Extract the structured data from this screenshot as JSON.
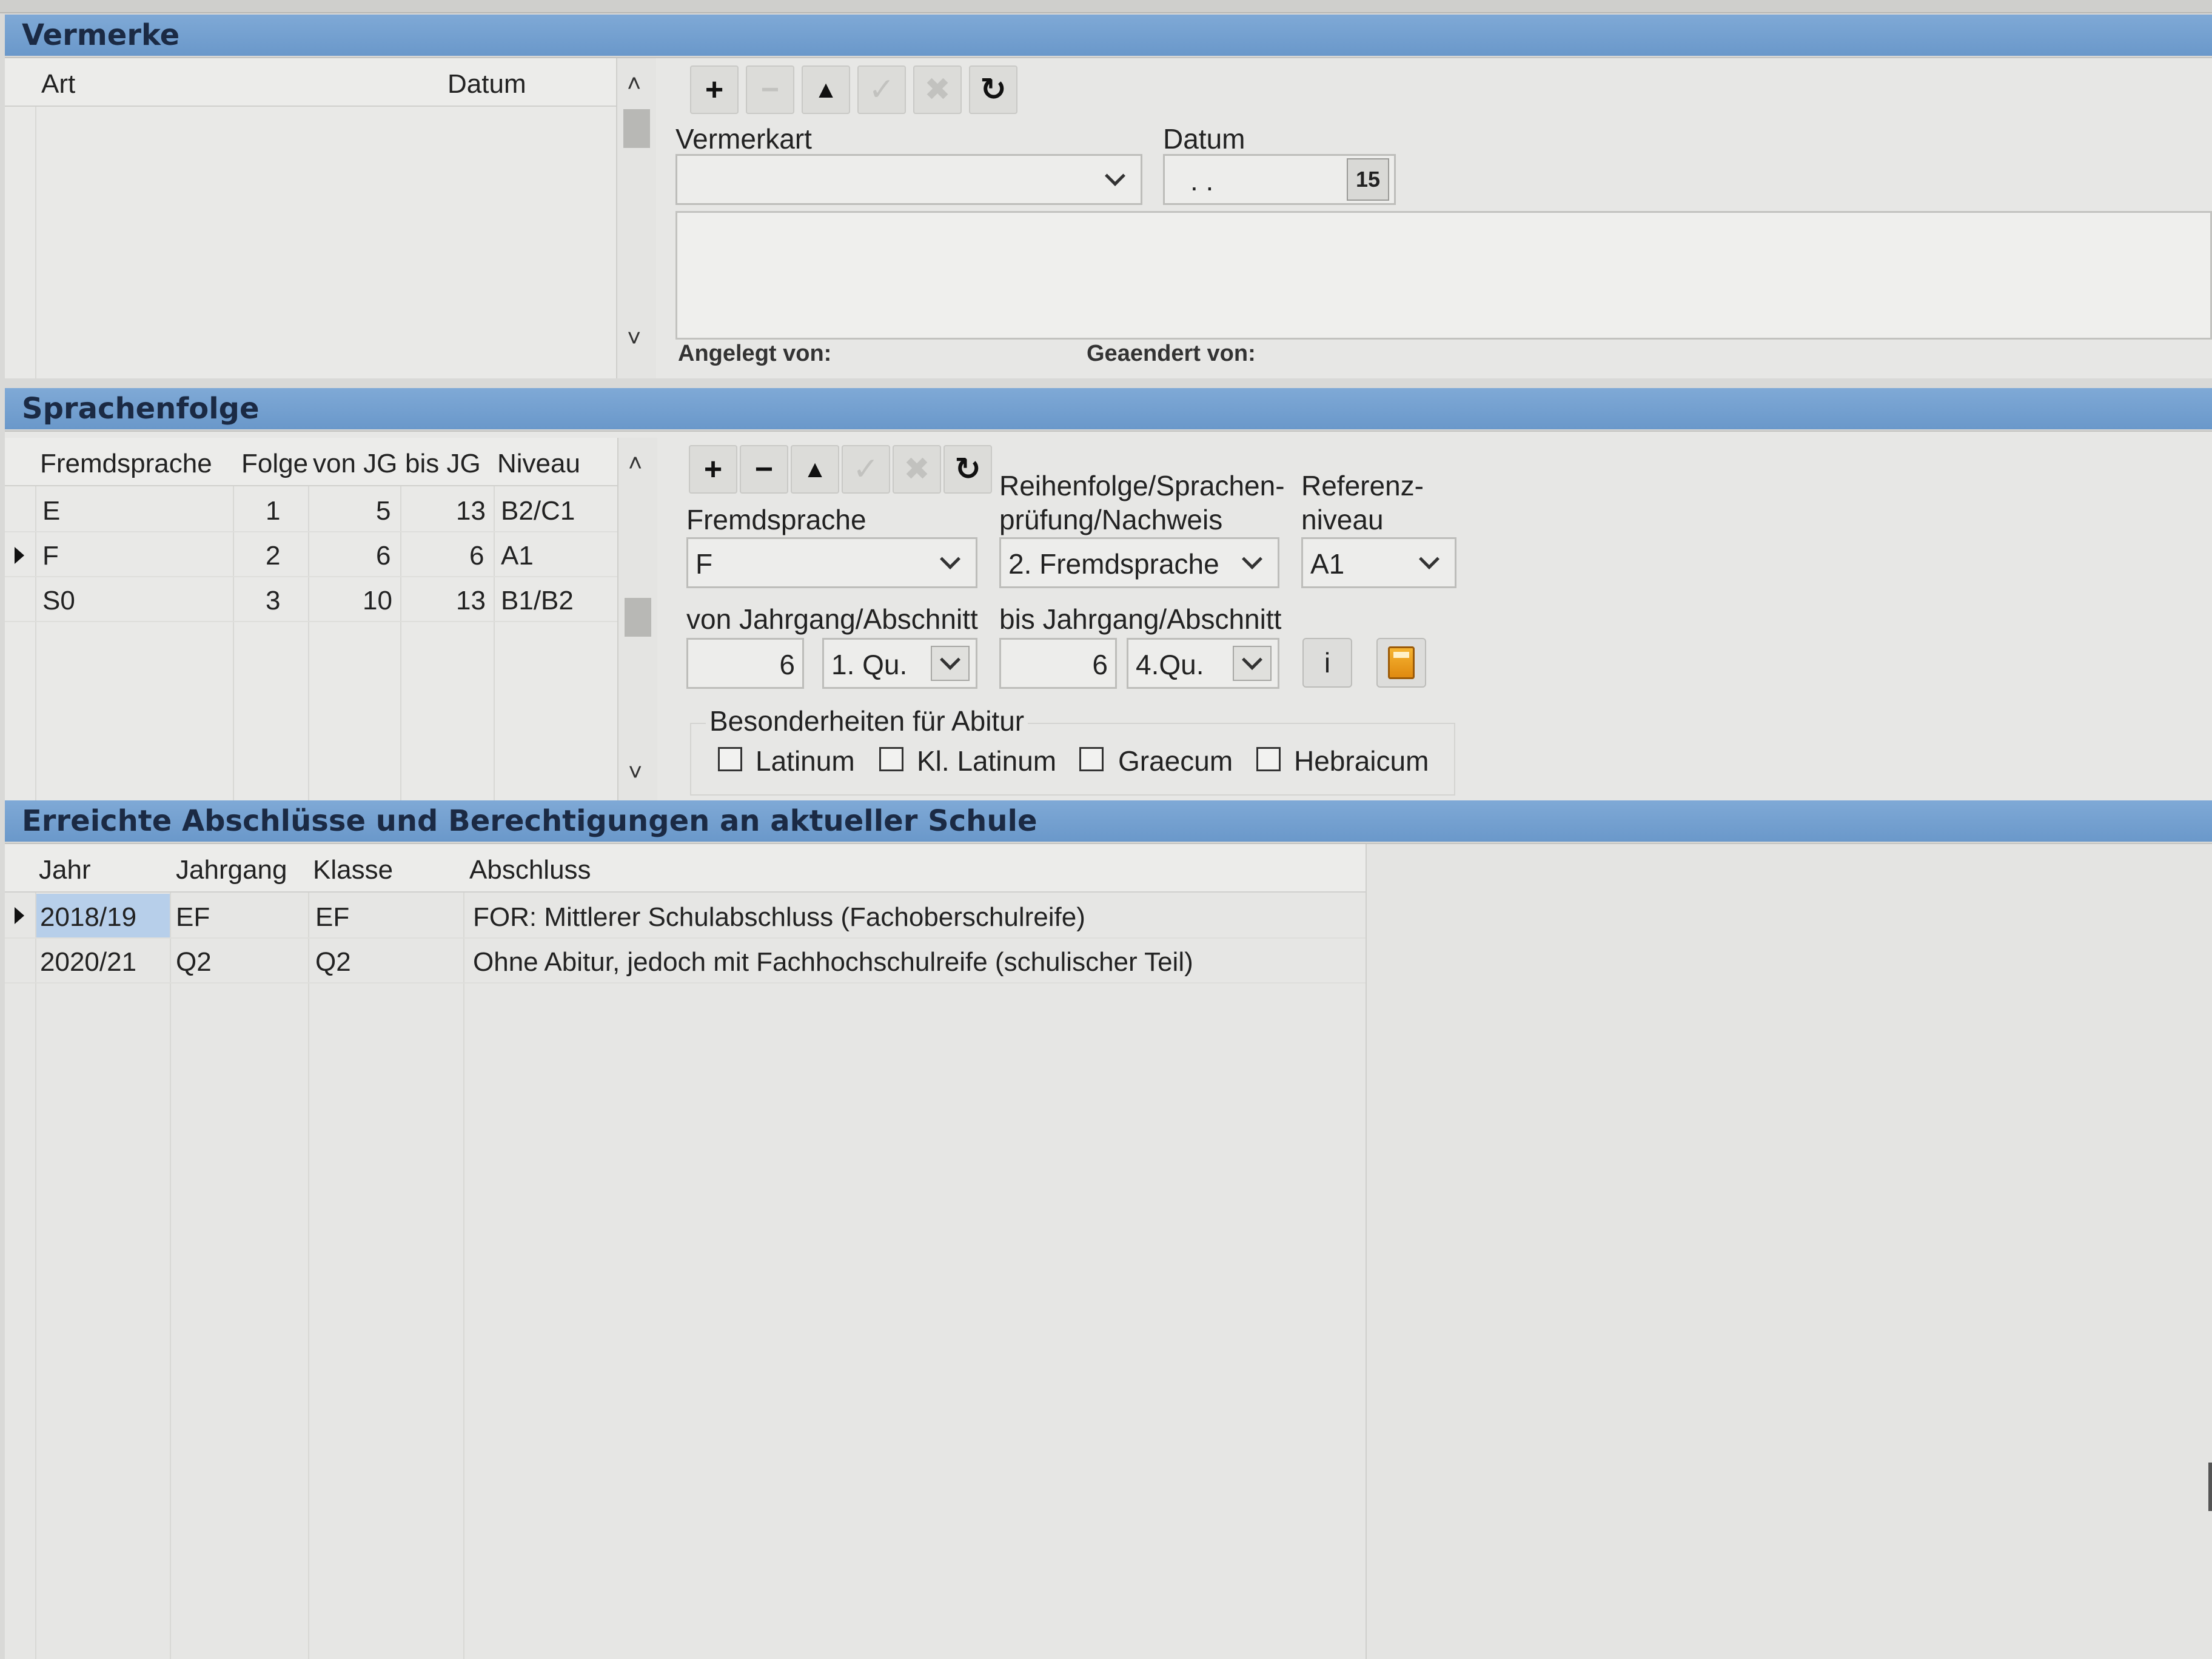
{
  "vermerke": {
    "title": "Vermerke",
    "columns": [
      "Art",
      "Datum"
    ],
    "form": {
      "vermerkart_label": "Vermerkart",
      "vermerkart_value": "",
      "datum_label": "Datum",
      "datum_value": ". .",
      "calendar_label": "15",
      "angelegt_label": "Angelegt von:",
      "geaendert_label": "Geaendert von:"
    }
  },
  "sprachenfolge": {
    "title": "Sprachenfolge",
    "columns": [
      "Fremdsprache",
      "Folge",
      "von JG",
      "bis JG",
      "Niveau"
    ],
    "rows": [
      {
        "sprache": "E",
        "folge": "1",
        "von": "5",
        "bis": "13",
        "niveau": "B2/C1"
      },
      {
        "sprache": "F",
        "folge": "2",
        "von": "6",
        "bis": "6",
        "niveau": "A1"
      },
      {
        "sprache": "S0",
        "folge": "3",
        "von": "10",
        "bis": "13",
        "niveau": "B1/B2"
      }
    ],
    "form": {
      "fremdsprache_label": "Fremdsprache",
      "fremdsprache_value": "F",
      "reihenfolge_label_1": "Reihenfolge/Sprachen-",
      "reihenfolge_label_2": "prüfung/Nachweis",
      "reihenfolge_value": "2. Fremdsprache",
      "referenz_label_1": "Referenz-",
      "referenz_label_2": "niveau",
      "referenz_value": "A1",
      "von_label": "von Jahrgang/Abschnitt",
      "von_jg_value": "6",
      "von_abschnitt_value": "1. Qu.",
      "bis_label": "bis Jahrgang/Abschnitt",
      "bis_jg_value": "6",
      "bis_abschnitt_value": "4.Qu.",
      "info_label": "i",
      "besonderheiten_label": "Besonderheiten für Abitur",
      "checkboxes": [
        "Latinum",
        "Kl. Latinum",
        "Graecum",
        "Hebraicum"
      ]
    }
  },
  "abschluesse": {
    "title": "Erreichte Abschlüsse und Berechtigungen an aktueller Schule",
    "columns": [
      "Jahr",
      "Jahrgang",
      "Klasse",
      "Abschluss"
    ],
    "rows": [
      {
        "jahr": "2018/19",
        "jahrgang": "EF",
        "klasse": "EF",
        "abschluss": "FOR: Mittlerer Schulabschluss (Fachoberschulreife)"
      },
      {
        "jahr": "2020/21",
        "jahrgang": "Q2",
        "klasse": "Q2",
        "abschluss": "Ohne Abitur, jedoch mit Fachhochschulreife (schulischer Teil)"
      }
    ]
  }
}
